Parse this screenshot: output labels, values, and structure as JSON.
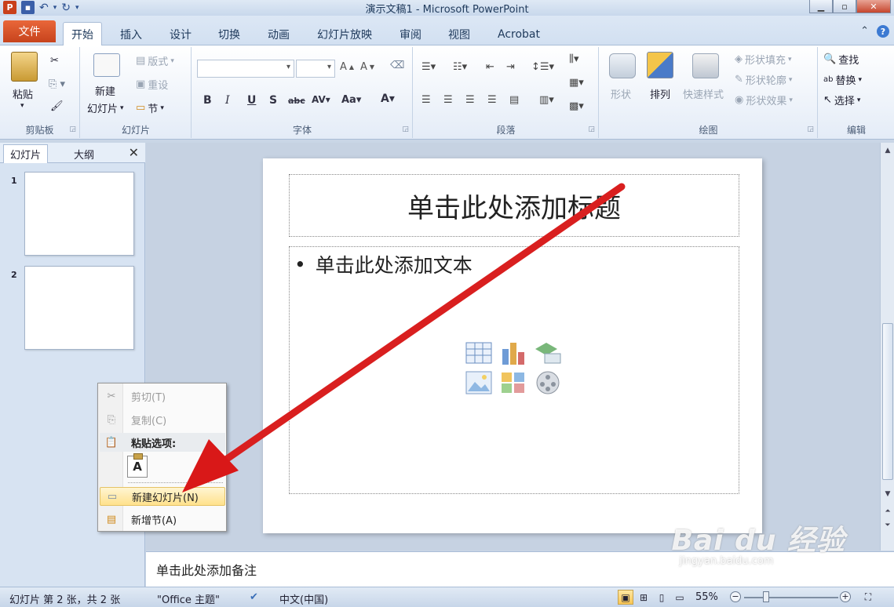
{
  "window": {
    "title": "演示文稿1 - Microsoft PowerPoint"
  },
  "qat": {
    "app_icon": "powerpoint-icon",
    "items": [
      "save-icon",
      "undo-icon",
      "redo-icon",
      "customize-icon"
    ]
  },
  "tabs": [
    {
      "label": "文件"
    },
    {
      "label": "开始"
    },
    {
      "label": "插入"
    },
    {
      "label": "设计"
    },
    {
      "label": "切换"
    },
    {
      "label": "动画"
    },
    {
      "label": "幻灯片放映"
    },
    {
      "label": "审阅"
    },
    {
      "label": "视图"
    },
    {
      "label": "Acrobat"
    }
  ],
  "ribbon": {
    "clipboard": {
      "label": "剪贴板",
      "paste": "粘贴"
    },
    "slides": {
      "label": "幻灯片",
      "new_slide": "新建",
      "new_slide2": "幻灯片",
      "layout": "版式",
      "reset": "重设",
      "section": "节"
    },
    "font": {
      "label": "字体"
    },
    "paragraph": {
      "label": "段落"
    },
    "drawing": {
      "label": "绘图",
      "shapes": "形状",
      "arrange": "排列",
      "quick_styles": "快速样式",
      "shape_fill": "形状填充",
      "shape_outline": "形状轮廓",
      "shape_effects": "形状效果"
    },
    "editing": {
      "label": "编辑",
      "find": "查找",
      "replace": "替换",
      "select": "选择"
    }
  },
  "slides_pane": {
    "tab_slides": "幻灯片",
    "tab_outline": "大纲",
    "thumbnails": [
      {
        "num": "1"
      },
      {
        "num": "2"
      }
    ]
  },
  "slide": {
    "title_placeholder": "单击此处添加标题",
    "body_placeholder": "单击此处添加文本"
  },
  "context_menu": {
    "cut": "剪切(T)",
    "copy": "复制(C)",
    "paste_options": "粘贴选项:",
    "paste_keep_text": "A",
    "new_slide": "新建幻灯片(N)",
    "new_section": "新增节(A)"
  },
  "notes": {
    "placeholder": "单击此处添加备注"
  },
  "status": {
    "slide_info": "幻灯片 第 2 张，共 2 张",
    "theme": "\"Office 主题\"",
    "language": "中文(中国)",
    "zoom": "55%"
  },
  "watermark": {
    "brand": "Bai du 经验",
    "url": "jingyan.baidu.com"
  },
  "colors": {
    "file_tab": "#c7431c",
    "arrow": "#e02020",
    "menu_hover": "#ffe18c"
  }
}
